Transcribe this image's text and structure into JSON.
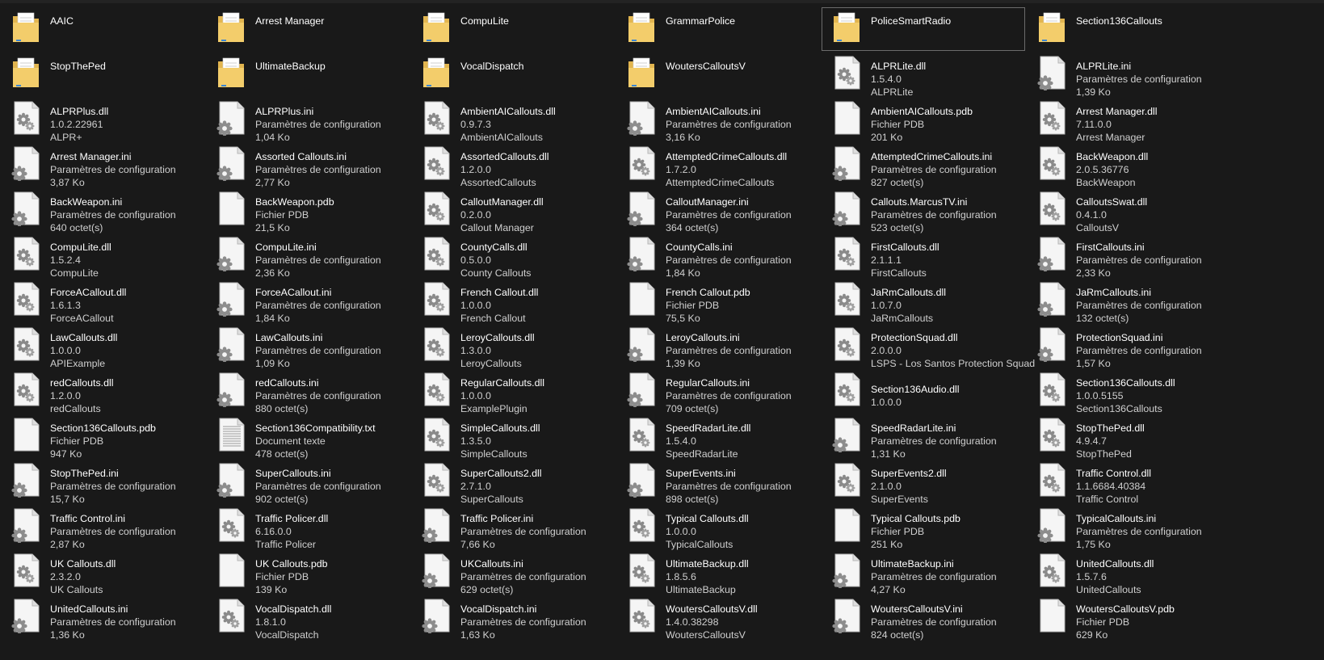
{
  "items": [
    {
      "name": "AAIC",
      "type": "folder"
    },
    {
      "name": "Arrest Manager",
      "type": "folder"
    },
    {
      "name": "CompuLite",
      "type": "folder"
    },
    {
      "name": "GrammarPolice",
      "type": "folder"
    },
    {
      "name": "PoliceSmartRadio",
      "type": "folder",
      "selected": true
    },
    {
      "name": "Section136Callouts",
      "type": "folder"
    },
    {
      "name": "StopThePed",
      "type": "folder"
    },
    {
      "name": "UltimateBackup",
      "type": "folder"
    },
    {
      "name": "VocalDispatch",
      "type": "folder"
    },
    {
      "name": "WoutersCalloutsV",
      "type": "folder"
    },
    {
      "name": "ALPRLite.dll",
      "type": "dll",
      "sub1": "1.5.4.0",
      "sub2": "ALPRLite"
    },
    {
      "name": "ALPRLite.ini",
      "type": "ini",
      "sub1": "Paramètres de configuration",
      "sub2": "1,39 Ko"
    },
    {
      "name": "ALPRPlus.dll",
      "type": "dll",
      "sub1": "1.0.2.22961",
      "sub2": "ALPR+"
    },
    {
      "name": "ALPRPlus.ini",
      "type": "ini",
      "sub1": "Paramètres de configuration",
      "sub2": "1,04 Ko"
    },
    {
      "name": "AmbientAICallouts.dll",
      "type": "dll",
      "sub1": "0.9.7.3",
      "sub2": "AmbientAICallouts"
    },
    {
      "name": "AmbientAICallouts.ini",
      "type": "ini",
      "sub1": "Paramètres de configuration",
      "sub2": "3,16 Ko"
    },
    {
      "name": "AmbientAICallouts.pdb",
      "type": "pdb",
      "sub1": "Fichier PDB",
      "sub2": "201 Ko"
    },
    {
      "name": "Arrest Manager.dll",
      "type": "dll",
      "sub1": "7.11.0.0",
      "sub2": "Arrest Manager"
    },
    {
      "name": "Arrest Manager.ini",
      "type": "ini",
      "sub1": "Paramètres de configuration",
      "sub2": "3,87 Ko"
    },
    {
      "name": "Assorted Callouts.ini",
      "type": "ini",
      "sub1": "Paramètres de configuration",
      "sub2": "2,77 Ko"
    },
    {
      "name": "AssortedCallouts.dll",
      "type": "dll",
      "sub1": "1.2.0.0",
      "sub2": "AssortedCallouts"
    },
    {
      "name": "AttemptedCrimeCallouts.dll",
      "type": "dll",
      "sub1": "1.7.2.0",
      "sub2": "AttemptedCrimeCallouts"
    },
    {
      "name": "AttemptedCrimeCallouts.ini",
      "type": "ini",
      "sub1": "Paramètres de configuration",
      "sub2": "827 octet(s)"
    },
    {
      "name": "BackWeapon.dll",
      "type": "dll",
      "sub1": "2.0.5.36776",
      "sub2": "BackWeapon"
    },
    {
      "name": "BackWeapon.ini",
      "type": "ini",
      "sub1": "Paramètres de configuration",
      "sub2": "640 octet(s)"
    },
    {
      "name": "BackWeapon.pdb",
      "type": "pdb",
      "sub1": "Fichier PDB",
      "sub2": "21,5 Ko"
    },
    {
      "name": "CalloutManager.dll",
      "type": "dll",
      "sub1": "0.2.0.0",
      "sub2": "Callout Manager"
    },
    {
      "name": "CalloutManager.ini",
      "type": "ini",
      "sub1": "Paramètres de configuration",
      "sub2": "364 octet(s)"
    },
    {
      "name": "Callouts.MarcusTV.ini",
      "type": "ini",
      "sub1": "Paramètres de configuration",
      "sub2": "523 octet(s)"
    },
    {
      "name": "CalloutsSwat.dll",
      "type": "dll",
      "sub1": "0.4.1.0",
      "sub2": "CalloutsV"
    },
    {
      "name": "CompuLite.dll",
      "type": "dll",
      "sub1": "1.5.2.4",
      "sub2": "CompuLite"
    },
    {
      "name": "CompuLite.ini",
      "type": "ini",
      "sub1": "Paramètres de configuration",
      "sub2": "2,36 Ko"
    },
    {
      "name": "CountyCalls.dll",
      "type": "dll",
      "sub1": "0.5.0.0",
      "sub2": "County Callouts"
    },
    {
      "name": "CountyCalls.ini",
      "type": "ini",
      "sub1": "Paramètres de configuration",
      "sub2": "1,84 Ko"
    },
    {
      "name": "FirstCallouts.dll",
      "type": "dll",
      "sub1": "2.1.1.1",
      "sub2": "FirstCallouts"
    },
    {
      "name": "FirstCallouts.ini",
      "type": "ini",
      "sub1": "Paramètres de configuration",
      "sub2": "2,33 Ko"
    },
    {
      "name": "ForceACallout.dll",
      "type": "dll",
      "sub1": "1.6.1.3",
      "sub2": "ForceACallout"
    },
    {
      "name": "ForceACallout.ini",
      "type": "ini",
      "sub1": "Paramètres de configuration",
      "sub2": "1,84 Ko"
    },
    {
      "name": "French Callout.dll",
      "type": "dll",
      "sub1": "1.0.0.0",
      "sub2": "French Callout"
    },
    {
      "name": "French Callout.pdb",
      "type": "pdb",
      "sub1": "Fichier PDB",
      "sub2": "75,5 Ko"
    },
    {
      "name": "JaRmCallouts.dll",
      "type": "dll",
      "sub1": "1.0.7.0",
      "sub2": "JaRmCallouts"
    },
    {
      "name": "JaRmCallouts.ini",
      "type": "ini",
      "sub1": "Paramètres de configuration",
      "sub2": "132 octet(s)"
    },
    {
      "name": "LawCallouts.dll",
      "type": "dll",
      "sub1": "1.0.0.0",
      "sub2": "APIExample"
    },
    {
      "name": "LawCallouts.ini",
      "type": "ini",
      "sub1": "Paramètres de configuration",
      "sub2": "1,09 Ko"
    },
    {
      "name": "LeroyCallouts.dll",
      "type": "dll",
      "sub1": "1.3.0.0",
      "sub2": "LeroyCallouts"
    },
    {
      "name": "LeroyCallouts.ini",
      "type": "ini",
      "sub1": "Paramètres de configuration",
      "sub2": "1,39 Ko"
    },
    {
      "name": "ProtectionSquad.dll",
      "type": "dll",
      "sub1": "2.0.0.0",
      "sub2": "LSPS - Los Santos Protection Squad"
    },
    {
      "name": "ProtectionSquad.ini",
      "type": "ini",
      "sub1": "Paramètres de configuration",
      "sub2": "1,57 Ko"
    },
    {
      "name": "redCallouts.dll",
      "type": "dll",
      "sub1": "1.2.0.0",
      "sub2": "redCallouts"
    },
    {
      "name": "redCallouts.ini",
      "type": "ini",
      "sub1": "Paramètres de configuration",
      "sub2": "880 octet(s)"
    },
    {
      "name": "RegularCallouts.dll",
      "type": "dll",
      "sub1": "1.0.0.0",
      "sub2": "ExamplePlugin"
    },
    {
      "name": "RegularCallouts.ini",
      "type": "ini",
      "sub1": "Paramètres de configuration",
      "sub2": "709 octet(s)"
    },
    {
      "name": "Section136Audio.dll",
      "type": "dll",
      "sub1": "1.0.0.0",
      "sub2": ""
    },
    {
      "name": "Section136Callouts.dll",
      "type": "dll",
      "sub1": "1.0.0.5155",
      "sub2": "Section136Callouts"
    },
    {
      "name": "Section136Callouts.pdb",
      "type": "pdb",
      "sub1": "Fichier PDB",
      "sub2": "947 Ko"
    },
    {
      "name": "Section136Compatibility.txt",
      "type": "txt",
      "sub1": "Document texte",
      "sub2": "478 octet(s)"
    },
    {
      "name": "SimpleCallouts.dll",
      "type": "dll",
      "sub1": "1.3.5.0",
      "sub2": "SimpleCallouts"
    },
    {
      "name": "SpeedRadarLite.dll",
      "type": "dll",
      "sub1": "1.5.4.0",
      "sub2": "SpeedRadarLite"
    },
    {
      "name": "SpeedRadarLite.ini",
      "type": "ini",
      "sub1": "Paramètres de configuration",
      "sub2": "1,31 Ko"
    },
    {
      "name": "StopThePed.dll",
      "type": "dll",
      "sub1": "4.9.4.7",
      "sub2": "StopThePed"
    },
    {
      "name": "StopThePed.ini",
      "type": "ini",
      "sub1": "Paramètres de configuration",
      "sub2": "15,7 Ko"
    },
    {
      "name": "SuperCallouts.ini",
      "type": "ini",
      "sub1": "Paramètres de configuration",
      "sub2": "902 octet(s)"
    },
    {
      "name": "SuperCallouts2.dll",
      "type": "dll",
      "sub1": "2.7.1.0",
      "sub2": "SuperCallouts"
    },
    {
      "name": "SuperEvents.ini",
      "type": "ini",
      "sub1": "Paramètres de configuration",
      "sub2": "898 octet(s)"
    },
    {
      "name": "SuperEvents2.dll",
      "type": "dll",
      "sub1": "2.1.0.0",
      "sub2": "SuperEvents"
    },
    {
      "name": "Traffic Control.dll",
      "type": "dll",
      "sub1": "1.1.6684.40384",
      "sub2": "Traffic Control"
    },
    {
      "name": "Traffic Control.ini",
      "type": "ini",
      "sub1": "Paramètres de configuration",
      "sub2": "2,87 Ko"
    },
    {
      "name": "Traffic Policer.dll",
      "type": "dll",
      "sub1": "6.16.0.0",
      "sub2": "Traffic Policer"
    },
    {
      "name": "Traffic Policer.ini",
      "type": "ini",
      "sub1": "Paramètres de configuration",
      "sub2": "7,66 Ko"
    },
    {
      "name": "Typical Callouts.dll",
      "type": "dll",
      "sub1": "1.0.0.0",
      "sub2": "TypicalCallouts"
    },
    {
      "name": "Typical Callouts.pdb",
      "type": "pdb",
      "sub1": "Fichier PDB",
      "sub2": "251 Ko"
    },
    {
      "name": "TypicalCallouts.ini",
      "type": "ini",
      "sub1": "Paramètres de configuration",
      "sub2": "1,75 Ko"
    },
    {
      "name": "UK Callouts.dll",
      "type": "dll",
      "sub1": "2.3.2.0",
      "sub2": "UK Callouts"
    },
    {
      "name": "UK Callouts.pdb",
      "type": "pdb",
      "sub1": "Fichier PDB",
      "sub2": "139 Ko"
    },
    {
      "name": "UKCallouts.ini",
      "type": "ini",
      "sub1": "Paramètres de configuration",
      "sub2": "629 octet(s)"
    },
    {
      "name": "UltimateBackup.dll",
      "type": "dll",
      "sub1": "1.8.5.6",
      "sub2": "UltimateBackup"
    },
    {
      "name": "UltimateBackup.ini",
      "type": "ini",
      "sub1": "Paramètres de configuration",
      "sub2": "4,27 Ko"
    },
    {
      "name": "UnitedCallouts.dll",
      "type": "dll",
      "sub1": "1.5.7.6",
      "sub2": "UnitedCallouts"
    },
    {
      "name": "UnitedCallouts.ini",
      "type": "ini",
      "sub1": "Paramètres de configuration",
      "sub2": "1,36 Ko"
    },
    {
      "name": "VocalDispatch.dll",
      "type": "dll",
      "sub1": "1.8.1.0",
      "sub2": "VocalDispatch"
    },
    {
      "name": "VocalDispatch.ini",
      "type": "ini",
      "sub1": "Paramètres de configuration",
      "sub2": "1,63 Ko"
    },
    {
      "name": "WoutersCalloutsV.dll",
      "type": "dll",
      "sub1": "1.4.0.38298",
      "sub2": "WoutersCalloutsV"
    },
    {
      "name": "WoutersCalloutsV.ini",
      "type": "ini",
      "sub1": "Paramètres de configuration",
      "sub2": "824 octet(s)"
    },
    {
      "name": "WoutersCalloutsV.pdb",
      "type": "pdb",
      "sub1": "Fichier PDB",
      "sub2": "629 Ko"
    }
  ],
  "icons": {
    "folder": "folder-icon",
    "dll": "dll-file-icon",
    "ini": "ini-file-icon",
    "pdb": "pdb-file-icon",
    "txt": "text-file-icon"
  },
  "colors": {
    "background": "#191919",
    "text_primary": "#ffffff",
    "text_secondary": "#cfcfcf",
    "folder": "#f3cd6b",
    "selection_border": "#6b6b6b"
  }
}
